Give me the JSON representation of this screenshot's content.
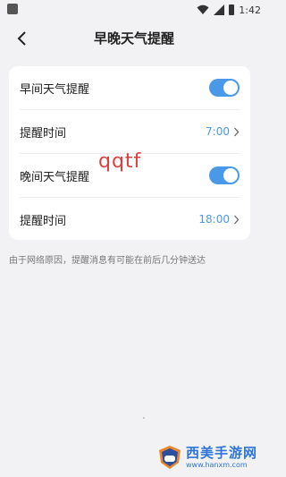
{
  "status_bar": {
    "time": "1:42"
  },
  "header": {
    "title": "早晚天气提醒"
  },
  "settings": {
    "morning_label": "早间天气提醒",
    "morning_time_label": "提醒时间",
    "morning_time_value": "7:00",
    "evening_label": "晚间天气提醒",
    "evening_time_label": "提醒时间",
    "evening_time_value": "18:00",
    "morning_enabled": true,
    "evening_enabled": true
  },
  "overlay_text": "qqtf",
  "note": "由于网络原因，提醒消息有可能在前后几分钟送达",
  "watermark": {
    "title": "西美手游网",
    "url": "www.hanxm.com"
  },
  "colors": {
    "accent": "#4a98e8",
    "background": "#f2f2f4"
  }
}
